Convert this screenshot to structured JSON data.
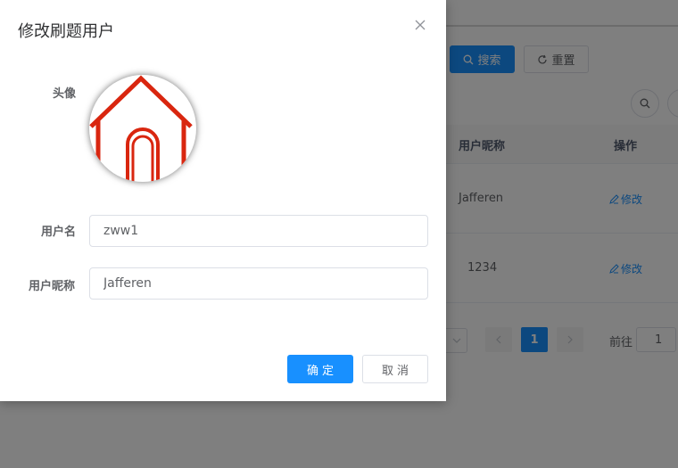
{
  "background": {
    "search_label": "搜索",
    "reset_label": "重置",
    "table": {
      "headers": [
        "用户昵称",
        "操作"
      ],
      "rows": [
        {
          "nickname": "Jafferen",
          "action": "修改"
        },
        {
          "nickname": "1234",
          "action": "修改"
        }
      ]
    },
    "pagination": {
      "current_page": "1",
      "goto_label": "前往",
      "goto_value": "1"
    }
  },
  "dialog": {
    "title": "修改刷题用户",
    "avatar_label": "头像",
    "username_label": "用户名",
    "username_value": "zww1",
    "nickname_label": "用户昵称",
    "nickname_value": "Jafferen",
    "confirm_label": "确定",
    "cancel_label": "取消"
  },
  "colors": {
    "primary": "#1890ff",
    "avatar_house": "#d9260f",
    "overlay": "rgba(0,0,0,0.5)"
  },
  "icons": {
    "close": "close-icon",
    "search": "search-icon",
    "refresh": "refresh-icon",
    "edit": "edit-icon"
  }
}
